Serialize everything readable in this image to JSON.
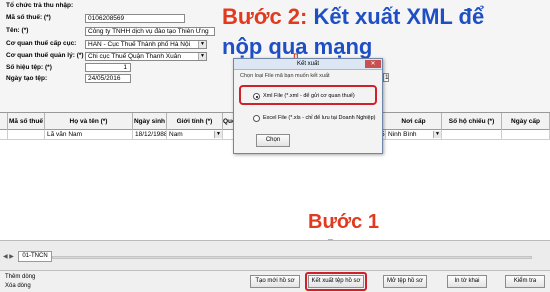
{
  "form": {
    "org_label": "Tổ chức trả thu nhập:",
    "tax_code_label": "Mã số thuế: (*)",
    "tax_code_value": "0106208569",
    "name_label": "Tên: (*)",
    "name_value": "Công ty TNHH dịch vụ đào tạo Thiên Ưng",
    "tax_dept_label": "Cơ quan thuế cấp cục:",
    "tax_dept_value": "HAN - Cục Thuế Thành phố Hà Nội",
    "tax_mgmt_label": "Cơ quan thuế quản lý: (*)",
    "tax_mgmt_value": "Chi cục Thuế Quận Thanh Xuân",
    "file_no_label": "Số hiệu tệp: (*)",
    "file_no_value": "1",
    "date_label": "Ngày tạo tệp:",
    "date_value": "24/05/2016",
    "right_field_value": "1"
  },
  "annotations": {
    "step2_prefix": "Bước 2:",
    "step2_rest": " Kết xuất XML để",
    "step2_line2": "nộp qua mạng",
    "step1": "Bước 1",
    "down_arrow": "⇩"
  },
  "grid": {
    "headers": [
      "Mã số thuế",
      "Họ và tên (*)",
      "Ngày sinh",
      "Giới tính (*)",
      "Quố",
      "Nơi cấp",
      "Số hộ chiếu (*)",
      "Ngày cấp"
    ],
    "row": {
      "name": "Lã văn Nam",
      "dob": "18/12/1988",
      "gender": "Nam",
      "place": "Ninh Bình",
      "mid": "5"
    }
  },
  "dialog": {
    "title": "Kết xuất",
    "group_label": "Chọn loại File mã bạn muốn kết xuất",
    "option1": "Xml File (*.xml - để gửi cơ quan thuế)",
    "option2": "Excel File (*.xls - chỉ để lưu tại Doanh Nghiệp)",
    "choose_btn": "Chọn",
    "close_icon": "✕"
  },
  "tab": {
    "sheet": "01-TNCN"
  },
  "bottom": {
    "add_row": "Thêm dòng",
    "delete_row": "Xóa dòng",
    "new_file": "Tạo mới hồ sơ",
    "export_file": "Kết xuất tệp hồ sơ",
    "open_file": "Mở tệp hồ sơ",
    "print": "In tờ khai",
    "check": "Kiểm tra"
  },
  "colors": {
    "annotation_red": "#e23a1e",
    "annotation_blue": "#1f4fc4",
    "highlight_red": "#d0202a"
  }
}
